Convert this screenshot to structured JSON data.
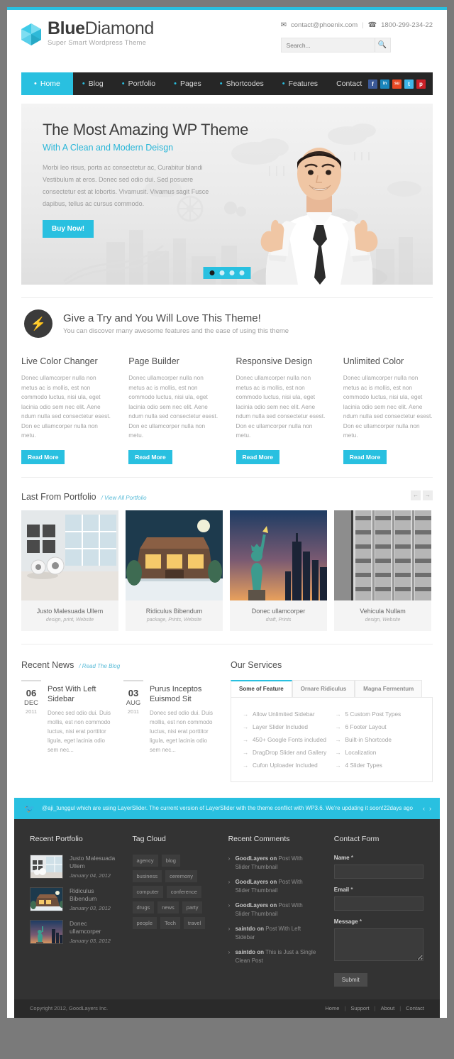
{
  "header": {
    "brand_bold": "Blue",
    "brand_light": "Diamond",
    "tagline": "Super Smart Wordpress Theme",
    "email": "contact@phoenix.com",
    "separator": "|",
    "phone": "1800-299-234-22",
    "mail_icon": "envelope-icon",
    "phone_icon": "phone-icon",
    "search_placeholder": "Search...",
    "search_value": "",
    "search_icon": "search-icon"
  },
  "nav": {
    "items": [
      {
        "label": "Home",
        "active": true,
        "bullet": "•"
      },
      {
        "label": "Blog",
        "active": false,
        "bullet": "•"
      },
      {
        "label": "Portfolio",
        "active": false,
        "bullet": "•"
      },
      {
        "label": "Pages",
        "active": false,
        "bullet": "•"
      },
      {
        "label": "Shortcodes",
        "active": false,
        "bullet": "•"
      },
      {
        "label": "Features",
        "active": false,
        "bullet": "•"
      },
      {
        "label": "Contact",
        "active": false,
        "bullet": ""
      }
    ],
    "social": [
      {
        "name": "facebook-icon",
        "glyph": "f",
        "color": "#3b5998"
      },
      {
        "name": "linkedin-icon",
        "glyph": "in",
        "color": "#1b86bc"
      },
      {
        "name": "stumbleupon-icon",
        "glyph": "su",
        "color": "#eb4924"
      },
      {
        "name": "twitter-icon",
        "glyph": "t",
        "color": "#3eb5e8"
      },
      {
        "name": "pinterest-icon",
        "glyph": "p",
        "color": "#cb2027"
      }
    ]
  },
  "hero": {
    "title": "The Most Amazing WP Theme",
    "subtitle": "With A Clean and Modern Deisgn",
    "paragraph": "Morbi leo risus, porta ac consectetur ac, Curabitur blandi Vestibulum at eros. Donec sed odio dui. Sed posuere consectetur est at lobortis. Vivamusit. Vivamus sagit Fusce dapibus, tellus ac cursus commodo.",
    "cta": "Buy Now!",
    "slides": 4,
    "active_slide": 1,
    "accent": "#29c0e0"
  },
  "try": {
    "icon": "bolt-icon",
    "title": "Give a Try and You Will Love This Theme!",
    "subtitle": "You can discover many awesome features and the ease of using this theme"
  },
  "features": {
    "body": "Donec ullamcorper nulla non metus ac is mollis, est non commodo luctus, nisi ula, eget lacinia odio sem nec elit. Aene ndum nulla sed consectetur esest. Don ec ullamcorper nulla non metu.",
    "read_more": "Read More",
    "items": [
      {
        "title": "Live Color Changer"
      },
      {
        "title": "Page Builder"
      },
      {
        "title": "Responsive Design"
      },
      {
        "title": "Unlimited Color"
      }
    ]
  },
  "portfolio": {
    "title": "Last From Portfolio",
    "link": "/ View All Portfolio",
    "prev_icon": "arrow-left-icon",
    "next_icon": "arrow-right-icon",
    "prev": "←",
    "next": "→",
    "items": [
      {
        "title": "Justo Malesuada Ullem",
        "tags": "design, print, Website",
        "kind": "room"
      },
      {
        "title": "Ridiculus Bibendum",
        "tags": "package, Prints, Website",
        "kind": "house"
      },
      {
        "title": "Donec ullamcorper",
        "tags": "draft, Prints",
        "kind": "statue"
      },
      {
        "title": "Vehicula Nullam",
        "tags": "design, Website",
        "kind": "building"
      }
    ]
  },
  "news": {
    "title": "Recent News",
    "link": "/ Read The Blog",
    "items": [
      {
        "day": "06",
        "month": "DEC",
        "year": "2011",
        "title": "Post With Left Sidebar",
        "excerpt": "Donec sed odio dui. Duis mollis, est non commodo luctus, nisi erat porttitor ligula, eget lacinia odio sem nec..."
      },
      {
        "day": "03",
        "month": "AUG",
        "year": "2011",
        "title": "Purus Inceptos Euismod Sit",
        "excerpt": "Donec sed odio dui. Duis mollis, est non commodo luctus, nisi erat porttitor ligula, eget lacinia odio sem nec..."
      }
    ]
  },
  "services": {
    "title": "Our Services",
    "tabs": [
      {
        "label": "Some of Feature",
        "active": true
      },
      {
        "label": "Ornare Ridiculus",
        "active": false
      },
      {
        "label": "Magna Fermentum",
        "active": false
      }
    ],
    "list_left": [
      "Allow Unlimited Sidebar",
      "Layer Slider Included",
      "450+ Google Fonts included",
      "DragDrop Slider and Gallery",
      "Cufon Uploader Included"
    ],
    "list_right": [
      "5 Custom Post Types",
      "6 Footer Layout",
      "Built-in Shortcode",
      "Localization",
      "4 Slider Types"
    ]
  },
  "twitter": {
    "icon": "twitter-bird-icon",
    "text": "@aji_tunggul which are using LayerSlider. The current version of LayerSlider with the theme conflict with WP3.6. We're updating it soon!22days ago",
    "prev": "‹",
    "next": "›"
  },
  "footer": {
    "recent_portfolio": {
      "title": "Recent Portfolio",
      "items": [
        {
          "title": "Justo Malesuada Ullem",
          "date": "January 04, 2012",
          "kind": "room"
        },
        {
          "title": "Ridiculus Bibendum",
          "date": "January 03, 2012",
          "kind": "house"
        },
        {
          "title": "Donec ullamcorper",
          "date": "January 03, 2012",
          "kind": "statue"
        }
      ]
    },
    "tag_cloud": {
      "title": "Tag Cloud",
      "tags": [
        "agency",
        "blog",
        "business",
        "ceremony",
        "computer",
        "conference",
        "drugs",
        "news",
        "party",
        "people",
        "Tech",
        "travel"
      ]
    },
    "recent_comments": {
      "title": "Recent Comments",
      "items": [
        {
          "author": "GoodLayers",
          "on": "on",
          "post": "Post With Slider Thumbnail"
        },
        {
          "author": "GoodLayers",
          "on": "on",
          "post": "Post With Slider Thumbnail"
        },
        {
          "author": "GoodLayers",
          "on": "on",
          "post": "Post With Slider Thumbnail"
        },
        {
          "author": "saintdo",
          "on": "on",
          "post": "Post With Left Sidebar"
        },
        {
          "author": "saintdo",
          "on": "on",
          "post": "This is Just a Single Clean Post"
        }
      ]
    },
    "contact_form": {
      "title": "Contact Form",
      "name_label": "Name",
      "name_value": "",
      "email_label": "Email",
      "email_value": "",
      "message_label": "Message",
      "message_value": "",
      "required": "*",
      "submit": "Submit"
    }
  },
  "copyright": {
    "text": "Copyright 2012, GoodLayers Inc.",
    "links": [
      "Home",
      "Support",
      "About",
      "Contact"
    ],
    "divider": "|"
  }
}
